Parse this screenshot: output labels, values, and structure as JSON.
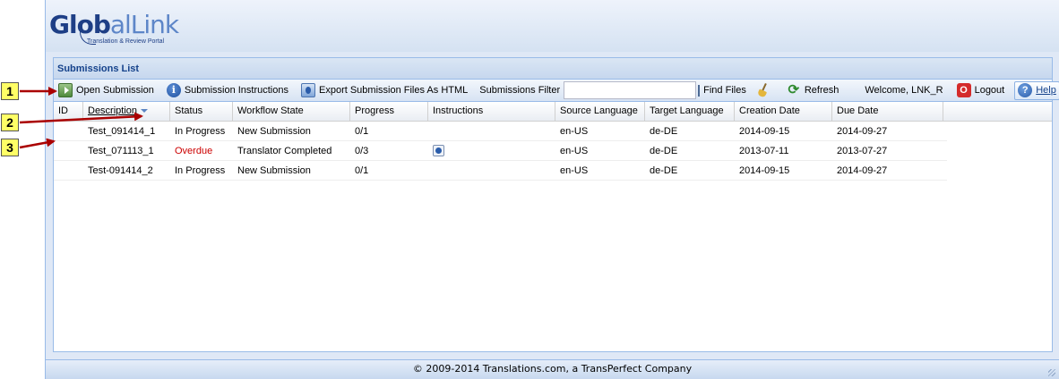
{
  "logo": {
    "part1": "Glob",
    "part2": "alLink",
    "tagline": "Translation & Review Portal"
  },
  "panel": {
    "title": "Submissions List"
  },
  "toolbar": {
    "open_submission": "Open Submission",
    "submission_instructions": "Submission Instructions",
    "export_html": "Export Submission Files As HTML",
    "filter_label": "Submissions Filter",
    "filter_value": "",
    "find_files": "Find Files",
    "find_files_checked": false,
    "refresh": "Refresh",
    "welcome": "Welcome, LNK_R",
    "logout": "Logout",
    "help": "Help"
  },
  "grid": {
    "columns": [
      "ID",
      "Description",
      "Status",
      "Workflow State",
      "Progress",
      "Instructions",
      "Source Language",
      "Target Language",
      "Creation Date",
      "Due Date"
    ],
    "sort_column": "Description",
    "rows": [
      {
        "id": "",
        "description": "Test_091414_1",
        "status": "In Progress",
        "workflow_state": "New Submission",
        "progress": "0/1",
        "has_instructions": false,
        "source_language": "en-US",
        "target_language": "de-DE",
        "creation_date": "2014-09-15",
        "due_date": "2014-09-27"
      },
      {
        "id": "",
        "description": "Test_071113_1",
        "status": "Overdue",
        "workflow_state": "Translator Completed",
        "progress": "0/3",
        "has_instructions": true,
        "source_language": "en-US",
        "target_language": "de-DE",
        "creation_date": "2013-07-11",
        "due_date": "2013-07-27"
      },
      {
        "id": "",
        "description": "Test-091414_2",
        "status": "In Progress",
        "workflow_state": "New Submission",
        "progress": "0/1",
        "has_instructions": false,
        "source_language": "en-US",
        "target_language": "de-DE",
        "creation_date": "2014-09-15",
        "due_date": "2014-09-27"
      }
    ]
  },
  "footer": {
    "text": "© 2009-2014 Translations.com, a TransPerfect Company"
  },
  "callouts": [
    "1",
    "2",
    "3"
  ],
  "colors": {
    "overdue": "#cc0000",
    "callout_bg": "#ffff66",
    "arrow": "#aa0000",
    "brand": "#1e3f86"
  }
}
